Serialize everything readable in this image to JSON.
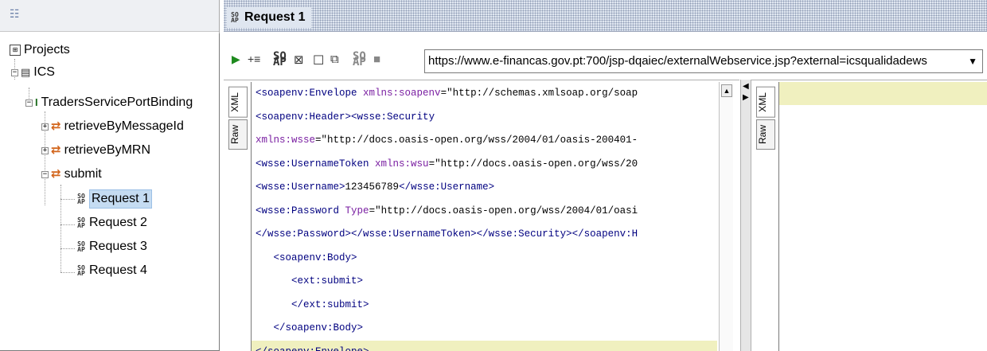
{
  "navigator": {
    "toolbar_icon": "list-icon",
    "tree": [
      {
        "label": "Projects",
        "icon": "projects-icon"
      },
      {
        "label": "ICS",
        "icon": "project-icon",
        "expander": "−"
      },
      {
        "label": "TradersServicePortBinding",
        "icon": "interface-icon",
        "expander": "−"
      },
      {
        "label": "retrieveByMessageId",
        "icon": "operation-icon",
        "expander": "+"
      },
      {
        "label": "retrieveByMRN",
        "icon": "operation-icon",
        "expander": "+"
      },
      {
        "label": "submit",
        "icon": "operation-icon",
        "expander": "−"
      },
      {
        "label": "Request 1",
        "icon": "soap-request-icon",
        "selected": true
      },
      {
        "label": "Request 2",
        "icon": "soap-request-icon"
      },
      {
        "label": "Request 3",
        "icon": "soap-request-icon"
      },
      {
        "label": "Request 4",
        "icon": "soap-request-icon"
      }
    ]
  },
  "editor": {
    "title": "Request 1",
    "title_icon": "soap-request-icon",
    "endpoint_url": "https://www.e-financas.gov.pt:700/jsp-dqaiec/externalWebservice.jsp?external=icsqualidadews",
    "toolbar_icons": [
      "run-icon",
      "add-step-icon",
      "soap-icon",
      "recreate-icon",
      "clone-icon",
      "copy-icon",
      "soap-icon",
      "stop-icon"
    ],
    "request_tabs": [
      "XML",
      "Raw"
    ],
    "response_tabs": [
      "XML",
      "Raw"
    ],
    "request_xml": [
      "<soapenv:Envelope xmlns:soapenv=\"http://schemas.xmlsoap.org/soap",
      "<soapenv:Header><wsse:Security",
      "xmlns:wsse=\"http://docs.oasis-open.org/wss/2004/01/oasis-200401-",
      "<wsse:UsernameToken xmlns:wsu=\"http://docs.oasis-open.org/wss/20",
      "<wsse:Username>123456789</wsse:Username>",
      "<wsse:Password Type=\"http://docs.oasis-open.org/wss/2004/01/oasi",
      "</wsse:Password></wsse:UsernameToken></wsse:Security></soapenv:H",
      "   <soapenv:Body>",
      "      <ext:submit>",
      "      </ext:submit>",
      "   </soapenv:Body>",
      "</soapenv:Envelope>"
    ]
  }
}
